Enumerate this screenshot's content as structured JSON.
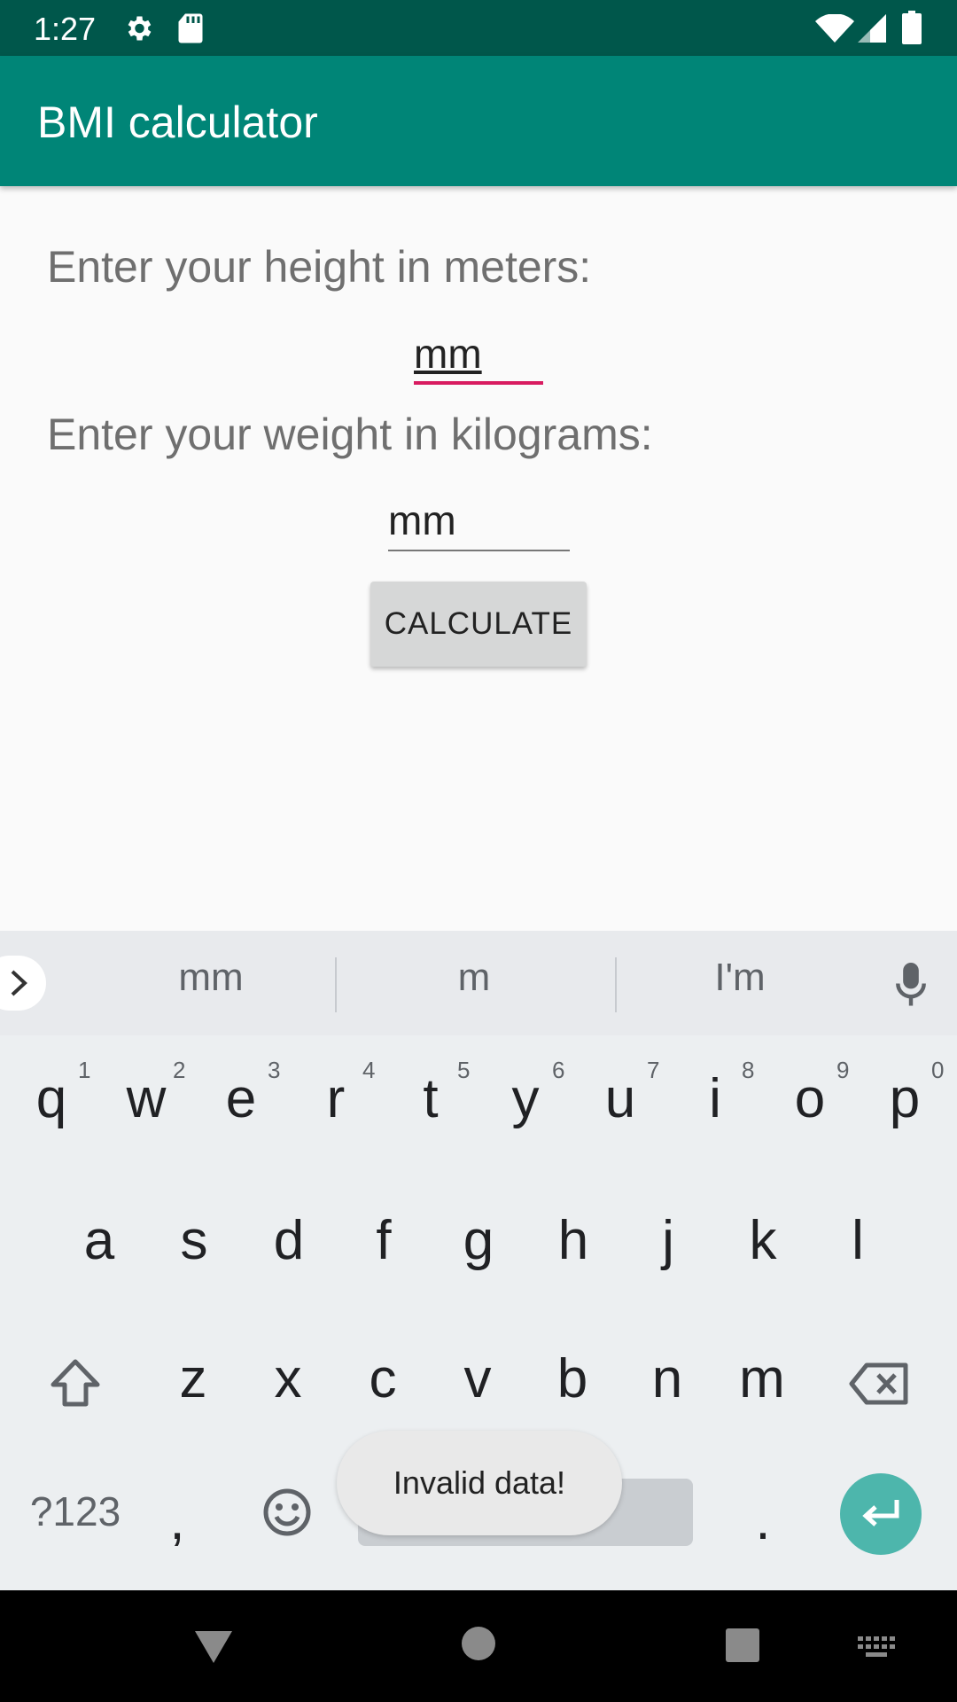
{
  "status_bar": {
    "time": "1:27",
    "icons": [
      "gear-icon",
      "sd-card-icon",
      "wifi-icon",
      "signal-icon",
      "battery-icon"
    ]
  },
  "app_bar": {
    "title": "BMI calculator",
    "color": "#008577"
  },
  "form": {
    "height_label": "Enter your height in meters:",
    "height_value": "mm",
    "weight_label": "Enter your weight in kilograms:",
    "weight_value": "mm",
    "calculate_label": "CALCULATE",
    "focus_color": "#d81b60"
  },
  "keyboard": {
    "suggestions": [
      "mm",
      "m",
      "I'm"
    ],
    "row1": [
      {
        "k": "q",
        "h": "1"
      },
      {
        "k": "w",
        "h": "2"
      },
      {
        "k": "e",
        "h": "3"
      },
      {
        "k": "r",
        "h": "4"
      },
      {
        "k": "t",
        "h": "5"
      },
      {
        "k": "y",
        "h": "6"
      },
      {
        "k": "u",
        "h": "7"
      },
      {
        "k": "i",
        "h": "8"
      },
      {
        "k": "o",
        "h": "9"
      },
      {
        "k": "p",
        "h": "0"
      }
    ],
    "row2": [
      "a",
      "s",
      "d",
      "f",
      "g",
      "h",
      "j",
      "k",
      "l"
    ],
    "row3": [
      "z",
      "x",
      "c",
      "v",
      "b",
      "n",
      "m"
    ],
    "symbols_label": "?123",
    "comma": ",",
    "period": ".",
    "enter_color": "#4db6ac"
  },
  "toast": {
    "message": "Invalid data!"
  }
}
